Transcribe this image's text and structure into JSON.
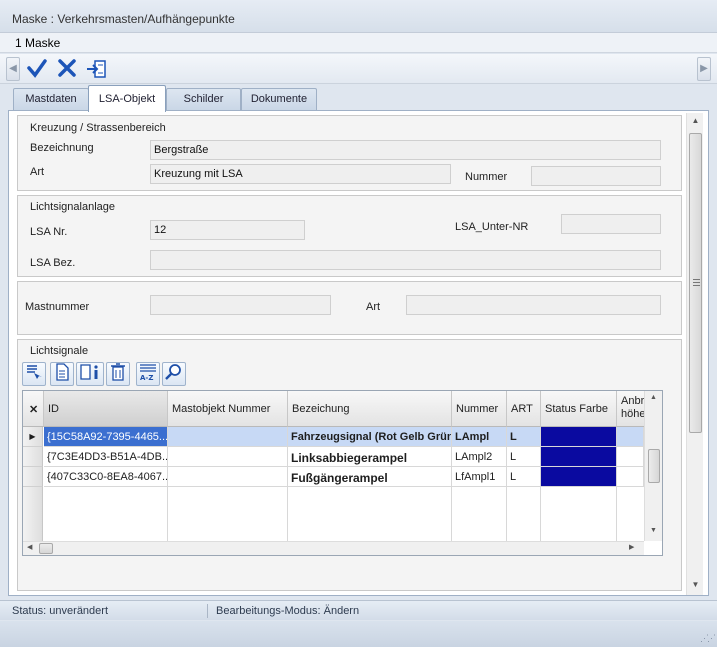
{
  "window": {
    "title": "Maske : Verkehrsmasten/Aufhängepunkte"
  },
  "menu": {
    "items": [
      {
        "label": "1 Maske"
      }
    ]
  },
  "toolbar": {
    "scroll_left_icon": "chevron-left-icon",
    "scroll_right_icon": "chevron-right-icon",
    "buttons": [
      {
        "icon": "check-icon"
      },
      {
        "icon": "close-icon"
      },
      {
        "icon": "export-icon"
      }
    ]
  },
  "tabs": [
    {
      "label": "Mastdaten"
    },
    {
      "label": "LSA-Objekt",
      "active": true
    },
    {
      "label": "Schilder"
    },
    {
      "label": "Dokumente"
    }
  ],
  "kreuzung": {
    "title": "Kreuzung / Strassenbereich",
    "bezeichnung_label": "Bezeichnung",
    "bezeichnung_value": "Bergstraße",
    "art_label": "Art",
    "art_value": "Kreuzung mit LSA",
    "nummer_label": "Nummer",
    "nummer_value": ""
  },
  "lichtsignalanlage": {
    "title": "Lichtsignalanlage",
    "lsa_nr_label": "LSA Nr.",
    "lsa_nr_value": "12",
    "unter_nr_label": "LSA_Unter-NR",
    "unter_nr_value": "",
    "lsa_bez_label": "LSA Bez.",
    "lsa_bez_value": ""
  },
  "mast": {
    "mastnummer_label": "Mastnummer",
    "mastnummer_value": "",
    "art_label": "Art",
    "art_value": ""
  },
  "lichtsignale": {
    "title": "Lichtsignale",
    "tool_icons": [
      "filter-icon",
      "document-icon",
      "info-icon",
      "delete-icon",
      "sort-az-icon",
      "search-icon"
    ],
    "columns": [
      "ID",
      "Mastobjekt Nummer",
      "Bezeichung",
      "Nummer",
      "ART",
      "Status Farbe",
      "Anbr höhe"
    ],
    "rows": [
      {
        "id": "{15C58A92-7395-4465...",
        "mastobjekt": "",
        "bezeichung": "Fahrzeugsignal (Rot Gelb Grün...",
        "nummer": "LAmpl",
        "art": "L",
        "status_color": "#0a0aa0",
        "selected": true
      },
      {
        "id": "{7C3E4DD3-B51A-4DB...",
        "mastobjekt": "",
        "bezeichung": "Linksabbiegerampel",
        "nummer": "LAmpl2",
        "art": "L",
        "status_color": "#0a0aa0",
        "selected": false
      },
      {
        "id": "{407C33C0-8EA8-4067...",
        "mastobjekt": "",
        "bezeichung": "Fußgängerampel",
        "nummer": "LfAmpl1",
        "art": "L",
        "status_color": "#0a0aa0",
        "selected": false
      }
    ]
  },
  "status": {
    "left": "Status: unverändert",
    "right": "Bearbeitungs-Modus: Ändern"
  }
}
